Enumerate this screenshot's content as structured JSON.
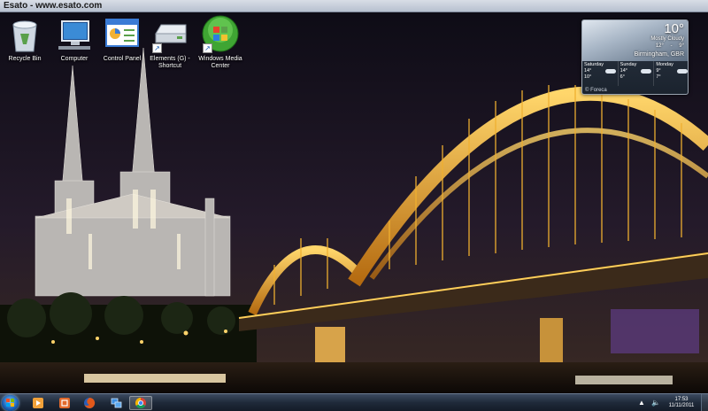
{
  "watermark": {
    "text": "Esato - www.esato.com"
  },
  "desktop": {
    "icons": [
      {
        "label": "Recycle Bin",
        "icon": "recycle-bin-icon"
      },
      {
        "label": "Computer",
        "icon": "computer-icon"
      },
      {
        "label": "Control Panel",
        "icon": "control-panel-icon"
      },
      {
        "label": "Elements (G) - Shortcut",
        "icon": "drive-icon"
      },
      {
        "label": "Windows Media Center",
        "icon": "media-center-icon"
      }
    ]
  },
  "weather": {
    "temperature": "10°",
    "condition": "Mostly Cloudy",
    "hilo": "12° - 9°",
    "location": "Birmingham, GBR",
    "forecast": [
      {
        "day": "Saturday",
        "high": "14°",
        "low": "10°"
      },
      {
        "day": "Sunday",
        "high": "14°",
        "low": "6°"
      },
      {
        "day": "Monday",
        "high": "9°",
        "low": "7°"
      }
    ],
    "source": "© Foreca"
  },
  "taskbar": {
    "items": [
      {
        "name": "media-player-icon",
        "color": "#f2a23a"
      },
      {
        "name": "smilebox-icon",
        "color": "#e26a2c"
      },
      {
        "name": "firefox-icon",
        "color": "#e2581a"
      },
      {
        "name": "network-icon",
        "color": "#3d8ee0"
      },
      {
        "name": "chrome-icon",
        "color": "#4caf50"
      }
    ],
    "clock": {
      "time": "17:53",
      "date": "11/11/2011"
    }
  },
  "colors": {
    "sky": "#1a1420",
    "bridge_gold": "#f0b030",
    "river": "#1a1510",
    "taskbar": "#1f2a3a"
  }
}
